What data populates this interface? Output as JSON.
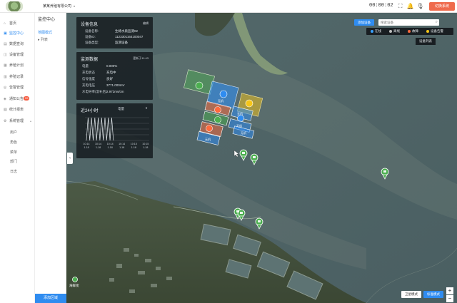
{
  "header": {
    "org_name": "某某养殖有限公司",
    "clock": "00:00:02",
    "exit_label": "切换系统",
    "icons": [
      "fullscreen-icon",
      "bell-icon",
      "mic-icon",
      "user-icon"
    ]
  },
  "sidebar": {
    "items": [
      {
        "icon": "home-icon",
        "label": "首页",
        "active": false
      },
      {
        "icon": "monitor-icon",
        "label": "监控中心",
        "active": true
      },
      {
        "icon": "data-icon",
        "label": "数据查询",
        "active": false
      },
      {
        "icon": "equipment-icon",
        "label": "设备管理",
        "active": false
      },
      {
        "icon": "plan-icon",
        "label": "养殖计划",
        "active": false
      },
      {
        "icon": "record-icon",
        "label": "养殖记录",
        "active": false
      },
      {
        "icon": "alarm-icon",
        "label": "告警管理",
        "active": false
      },
      {
        "icon": "notice-icon",
        "label": "通知公告",
        "active": false,
        "badge": "99"
      },
      {
        "icon": "stats-icon",
        "label": "统计报表",
        "active": false
      },
      {
        "icon": "settings-icon",
        "label": "系统管理",
        "active": false
      }
    ],
    "sub_items": [
      "用户",
      "角色",
      "菜单",
      "部门",
      "日志"
    ]
  },
  "subpanel": {
    "title": "监控中心",
    "rows": [
      {
        "label": "地图模式",
        "active": true
      },
      {
        "label": "▸ 列表",
        "active": false
      }
    ],
    "footer": "添加区域"
  },
  "device_panel": {
    "title": "设备信息",
    "action": "编辑",
    "fields": [
      {
        "label": "设备名称:",
        "value": "生蚝水质监测02"
      },
      {
        "label": "设备ID:",
        "value": "1123301164100047"
      },
      {
        "label": "设备类型:",
        "value": "监测设备"
      }
    ]
  },
  "monitor_panel": {
    "title": "监测数据",
    "updated": "更新于11:43",
    "rows": [
      {
        "label": "电量",
        "value": "0.000%"
      },
      {
        "label": "充电状态",
        "value": "充电中"
      },
      {
        "label": "信号强度",
        "value": "良好"
      },
      {
        "label": "充电电压",
        "value": "3771.000mV"
      },
      {
        "label": "水电导率(温补后)",
        "value": "2.972ms/cm"
      }
    ]
  },
  "chart_panel": {
    "title": "近24小时",
    "selector": "电量"
  },
  "chart_data": {
    "type": "line",
    "title": "近24小时",
    "x": [
      "10:14 1-18",
      "10:14 1-18",
      "10:14 1-18",
      "10:14 1-18",
      "10:15 1-18",
      "10:15 1-18"
    ],
    "values": [
      0,
      100,
      0,
      100,
      0,
      100,
      0,
      100,
      0,
      100,
      0,
      100,
      0,
      100,
      0,
      100,
      0
    ],
    "ylim": [
      0,
      100
    ],
    "grid": true
  },
  "map_controls": {
    "add_device": "添加设备",
    "search_placeholder": "搜索设备",
    "legend": [
      {
        "label": "在线",
        "color": "#3aa1ff"
      },
      {
        "label": "离线",
        "color": "#bfbfbf"
      },
      {
        "label": "故障",
        "color": "#ff6a3d"
      },
      {
        "label": "设备告警",
        "color": "#f5c518"
      }
    ],
    "device_list": "设备列表",
    "satellite_btn": "卫星模式",
    "standard_btn": "标准模式",
    "zoom_in": "+",
    "zoom_out": "−",
    "place_label": "海鲜街"
  },
  "map_zones": [
    {
      "label": "",
      "color": "#4caf50"
    },
    {
      "label": "无机",
      "color": "#2f8cf0"
    },
    {
      "label": "",
      "color": "#f5c518"
    },
    {
      "label": "",
      "color": "#ff6a3d"
    },
    {
      "label": "",
      "color": "#4caf50"
    },
    {
      "label": "无机",
      "color": "#2f8cf0"
    },
    {
      "label": "",
      "color": "#ff6a3d"
    },
    {
      "label": "无机",
      "color": "#2f8cf0"
    },
    {
      "label": "无机",
      "color": "#2f8cf0"
    },
    {
      "label": "无机",
      "color": "#2f8cf0"
    }
  ]
}
